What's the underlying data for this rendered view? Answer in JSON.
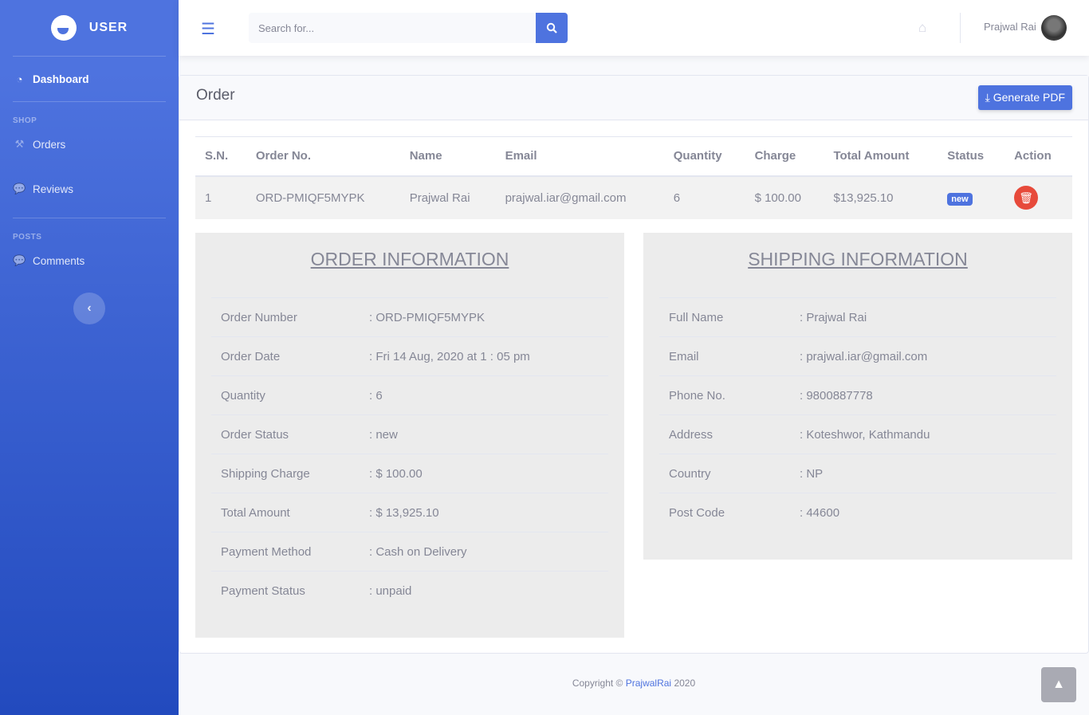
{
  "sidebar": {
    "brand": "USER",
    "dashboard": "Dashboard",
    "shop_heading": "SHOP",
    "orders": "Orders",
    "reviews": "Reviews",
    "posts_heading": "POSTS",
    "comments": "Comments"
  },
  "topbar": {
    "search_placeholder": "Search for...",
    "user_name": "Prajwal Rai"
  },
  "card": {
    "title": "Order",
    "pdf_label": "Generate PDF"
  },
  "table": {
    "headers": [
      "S.N.",
      "Order No.",
      "Name",
      "Email",
      "Quantity",
      "Charge",
      "Total Amount",
      "Status",
      "Action"
    ],
    "row": {
      "sn": "1",
      "order_no": "ORD-PMIQF5MYPK",
      "name": "Prajwal Rai",
      "email": "prajwal.iar@gmail.com",
      "quantity": "6",
      "charge": "$ 100.00",
      "total": "$13,925.10",
      "status": "new"
    }
  },
  "order_info": {
    "title": "ORDER INFORMATION",
    "rows": [
      {
        "label": "Order Number",
        "value": ": ORD-PMIQF5MYPK"
      },
      {
        "label": "Order Date",
        "value": ": Fri 14 Aug, 2020 at 1 : 05 pm"
      },
      {
        "label": "Quantity",
        "value": ": 6"
      },
      {
        "label": "Order Status",
        "value": ": new"
      },
      {
        "label": "Shipping Charge",
        "value": ": $ 100.00"
      },
      {
        "label": "Total Amount",
        "value": ": $ 13,925.10"
      },
      {
        "label": "Payment Method",
        "value": ": Cash on Delivery"
      },
      {
        "label": "Payment Status",
        "value": ": unpaid"
      }
    ]
  },
  "shipping_info": {
    "title": "SHIPPING INFORMATION",
    "rows": [
      {
        "label": "Full Name",
        "value": ": Prajwal Rai"
      },
      {
        "label": "Email",
        "value": ": prajwal.iar@gmail.com"
      },
      {
        "label": "Phone No.",
        "value": ": 9800887778"
      },
      {
        "label": "Address",
        "value": ": Koteshwor, Kathmandu"
      },
      {
        "label": "Country",
        "value": ": NP"
      },
      {
        "label": "Post Code",
        "value": ": 44600"
      }
    ]
  },
  "footer": {
    "prefix": "Copyright ©",
    "link": "PrajwalRai",
    "year": "2020"
  },
  "colors": {
    "primary": "#4e73df",
    "danger": "#e74a3b"
  }
}
